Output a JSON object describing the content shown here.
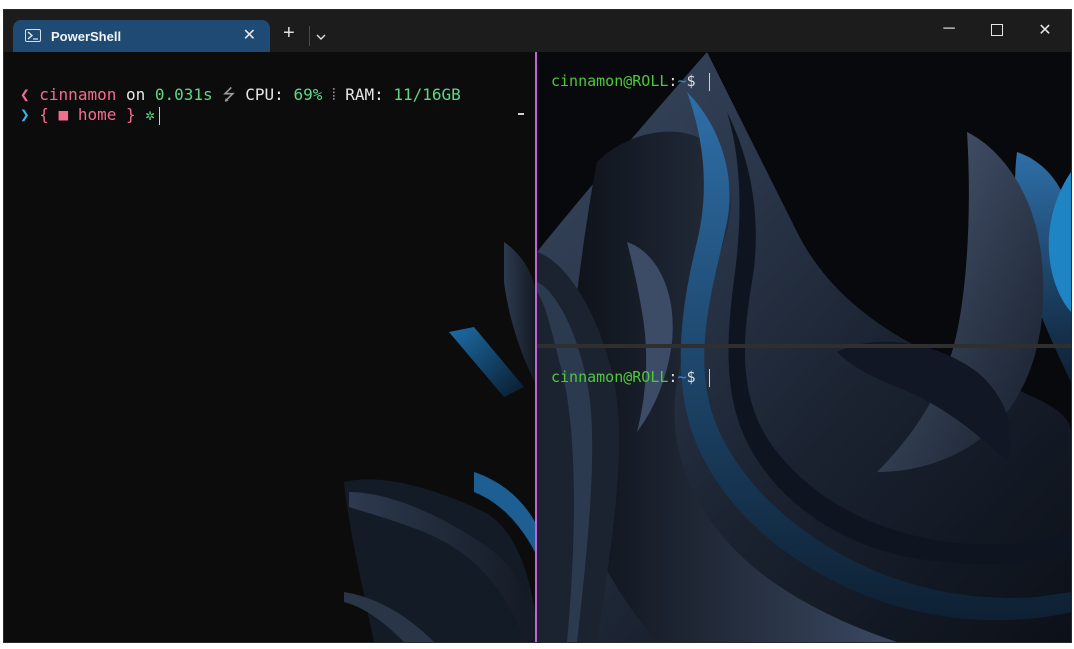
{
  "window": {
    "tab_title": "PowerShell",
    "tab_close": "✕",
    "new_tab": "+",
    "dropdown": "⌄",
    "minimize": "─",
    "close": "✕"
  },
  "left_pane": {
    "line1": {
      "chevron": "❮",
      "user": "cinnamon",
      "on": " on ",
      "time": "0.031s",
      "sep1": " ⭍ ",
      "cpu_label": "CPU: ",
      "cpu_value": "69%",
      "sep2": " ⦙ ",
      "ram_label": "RAM: ",
      "ram_value": "11/16GB"
    },
    "line2": {
      "chevron": "❯",
      "open_brace": " { ",
      "folder_icon": "■",
      "dir": " home",
      "close_brace": " }",
      "status_icon": " ✲"
    }
  },
  "right_top_pane": {
    "user_host": "cinnamon@ROLL",
    "colon": ":",
    "path": "~",
    "prompt": "$ "
  },
  "right_bottom_pane": {
    "user_host": "cinnamon@ROLL",
    "colon": ":",
    "path": "~",
    "prompt": "$ "
  },
  "colors": {
    "tab_active": "#1e4a73",
    "split_border": "#c264d6",
    "prompt_green": "#4ec93a",
    "path_blue": "#3a8ee6"
  }
}
